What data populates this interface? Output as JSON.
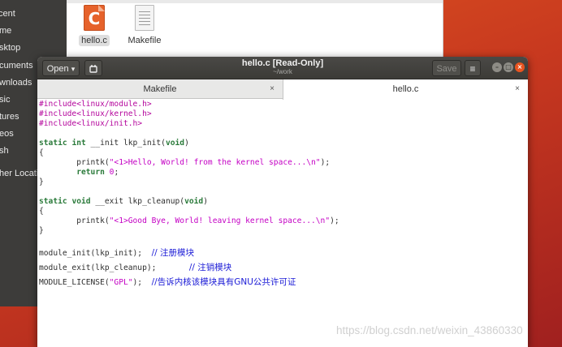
{
  "file_manager": {
    "sidebar": [
      {
        "label": "cent",
        "icon": "recent-icon"
      },
      {
        "label": "me",
        "icon": "home-icon"
      },
      {
        "label": "sktop",
        "icon": "desktop-icon"
      },
      {
        "label": "cuments",
        "icon": "documents-icon"
      },
      {
        "label": "wnloads",
        "icon": "downloads-icon"
      },
      {
        "label": "sic",
        "icon": "music-icon"
      },
      {
        "label": "tures",
        "icon": "pictures-icon"
      },
      {
        "label": "eos",
        "icon": "videos-icon"
      },
      {
        "label": "sh",
        "icon": "trash-icon"
      },
      {
        "label": "her Locations",
        "icon": "other-locations-icon"
      }
    ],
    "files": [
      {
        "name": "hello.c",
        "icon": "c-source-file-icon",
        "icon_letter": "C",
        "selected": true
      },
      {
        "name": "Makefile",
        "icon": "text-file-icon",
        "selected": false
      }
    ]
  },
  "gedit": {
    "open_label": "Open",
    "open_arrow": "▾",
    "title": "hello.c [Read-Only]",
    "subtitle": "~/work",
    "save_label": "Save",
    "menu_icon": "≡",
    "tabs": [
      {
        "label": "Makefile",
        "close": "×",
        "active": false
      },
      {
        "label": "hello.c",
        "close": "×",
        "active": true
      }
    ],
    "code": {
      "inc1": "#include<linux/module.h>",
      "inc2": "#include<linux/kernel.h>",
      "inc3": "#include<linux/init.h>",
      "kw_static": "static",
      "kw_int": "int",
      "init_sig": " __init lkp_init(",
      "kw_void": "void",
      "close_paren": ")",
      "open_brace": "{",
      "close_brace": "}",
      "printk": "        printk(",
      "str1": "\"<1>Hello, World! from the kernel space...\\n\"",
      "stmt_end": ");",
      "ret_indent": "        ",
      "kw_return": "return",
      "zero": "0",
      "semi": ";",
      "kw_void2": "void",
      "exit_sig": " __exit lkp_cleanup(",
      "str2": "\"<1>Good Bye, World! leaving kernel space...\\n\"",
      "mod_init": "module_init(lkp_init);  ",
      "cm1": "// 注册模块",
      "mod_exit": "module_exit(lkp_cleanup);       ",
      "cm2": "// 注销模块",
      "license_pre": "MODULE_LICENSE(",
      "license_str": "\"GPL\"",
      "license_post": ");  ",
      "cm3": "//告诉内核该模块具有GNU公共许可证"
    }
  },
  "watermark": "https://blog.csdn.net/weixin_43860330",
  "colors": {
    "desktop": "#d04a1f",
    "headerbar": "#3c3b37",
    "preprocessor": "#b4059c",
    "keyword": "#2a7a3a",
    "string": "#c400c4",
    "comment": "#1a1ad6"
  }
}
